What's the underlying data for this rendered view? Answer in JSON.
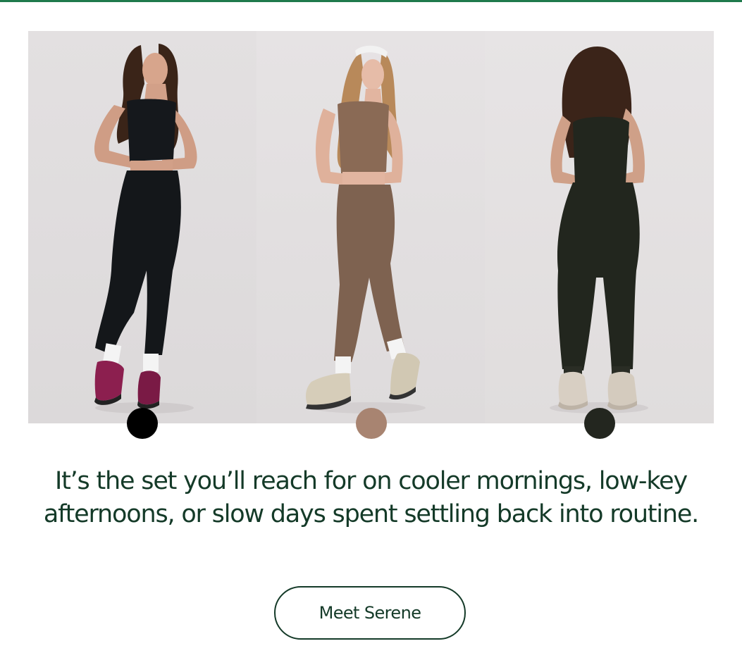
{
  "gallery": {
    "items": [
      {
        "colorway": "black",
        "swatch_color": "#000000",
        "outfit_color": "#14171a"
      },
      {
        "colorway": "mocha",
        "swatch_color": "#a88471",
        "outfit_color": "#7e6250"
      },
      {
        "colorway": "olive",
        "swatch_color": "#23261f",
        "outfit_color": "#22261e"
      }
    ]
  },
  "copy": {
    "headline": "It’s the set you’ll reach for on cooler mornings, low-key afternoons, or slow days spent settling back into routine."
  },
  "cta": {
    "label": "Meet Serene"
  },
  "colors": {
    "accent_green": "#1f7a4c",
    "text_dark_green": "#143a28"
  }
}
